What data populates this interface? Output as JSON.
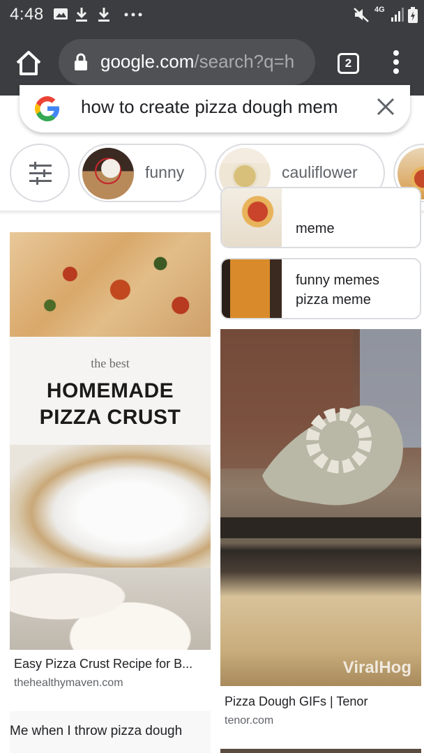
{
  "status_bar": {
    "time": "4:48",
    "network": "4G",
    "icons": [
      "image-icon",
      "download-icon",
      "download-icon",
      "more-dots-icon",
      "mute-icon",
      "signal-icon",
      "battery-icon"
    ]
  },
  "browser": {
    "url_domain": "google.com",
    "url_path": "/search?q=h",
    "tab_count": "2",
    "icons": [
      "home-icon",
      "lock-icon",
      "more-vert-icon"
    ]
  },
  "search": {
    "query": "how to create pizza dough mem",
    "icons": [
      "google-logo",
      "clear-icon"
    ]
  },
  "chips": [
    {
      "label": ""
    },
    {
      "label": "funny"
    },
    {
      "label": "cauliflower"
    }
  ],
  "results": {
    "left": {
      "image_small_text": "the best",
      "image_big_line1": "HOMEMADE",
      "image_big_line2": "PIZZA CRUST",
      "title": "Easy Pizza Crust Recipe for B...",
      "source": "thehealthymaven.com"
    },
    "left_next": {
      "text": "Me when I throw pizza dough"
    },
    "related": [
      {
        "text": "meme"
      },
      {
        "line1": "funny memes",
        "line2": "pizza meme"
      }
    ],
    "right": {
      "watermark": "ViralHog",
      "title": "Pizza Dough GIFs | Tenor",
      "source": "tenor.com"
    }
  },
  "colors": {
    "chrome_bg": "#3b3d40",
    "url_bg": "#4f5154",
    "chip_border": "#dadce0",
    "secondary_text": "#5f6368"
  }
}
